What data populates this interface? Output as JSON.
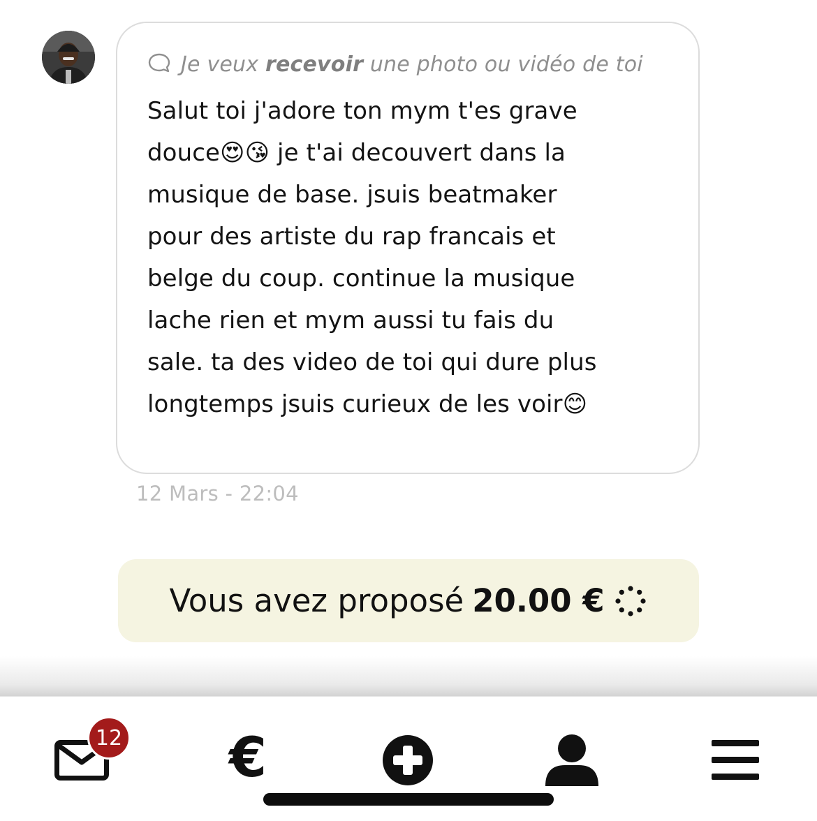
{
  "message": {
    "request_prefix": "Je veux ",
    "request_keyword": "recevoir",
    "request_suffix": " une photo ou vidéo de toi",
    "body_lines": [
      "Salut toi j'adore ton mym t'es grave",
      "douce",
      " je t'ai decouvert dans la",
      "musique de base. jsuis beatmaker",
      "pour des artiste du rap francais et",
      "belge du coup. continue la musique",
      "lache rien et mym aussi tu fais du",
      "sale. ta des video de toi qui dure plus",
      "longtemps jsuis curieux de les voir"
    ],
    "emoji_after_douce": "😍😘",
    "emoji_end": "😊",
    "timestamp": "12 Mars - 22:04"
  },
  "offer": {
    "prefix": "Vous avez proposé",
    "amount": "20.00 €",
    "status_icon": "loading-spinner-icon",
    "background": "#f5f4e1"
  },
  "navbar": {
    "messages_badge": "12",
    "euro_symbol": "€",
    "badge_color": "#a31b1b",
    "icons": [
      "envelope-icon",
      "euro-icon",
      "plus-circle-icon",
      "user-icon",
      "menu-icon"
    ]
  }
}
